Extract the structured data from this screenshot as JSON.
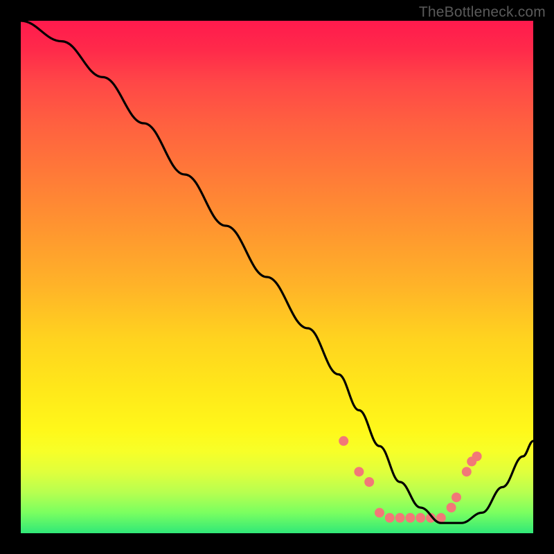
{
  "watermark": "TheBottleneck.com",
  "chart_data": {
    "type": "line",
    "title": "",
    "xlabel": "",
    "ylabel": "",
    "xlim": [
      0,
      100
    ],
    "ylim": [
      0,
      100
    ],
    "series": [
      {
        "name": "curve",
        "color": "#000000",
        "x": [
          0,
          8,
          16,
          24,
          32,
          40,
          48,
          56,
          62,
          66,
          70,
          74,
          78,
          82,
          86,
          90,
          94,
          98,
          100
        ],
        "y": [
          100,
          96,
          89,
          80,
          70,
          60,
          50,
          40,
          31,
          24,
          17,
          10,
          5,
          2,
          2,
          4,
          9,
          15,
          18
        ]
      }
    ],
    "markers": {
      "name": "dots",
      "color": "#f27878",
      "radius_px": 7,
      "x": [
        63,
        66,
        68,
        70,
        72,
        74,
        76,
        78,
        80,
        82,
        84,
        85,
        87,
        88,
        89
      ],
      "y": [
        18,
        12,
        10,
        4,
        3,
        3,
        3,
        3,
        3,
        3,
        5,
        7,
        12,
        14,
        15
      ]
    }
  }
}
